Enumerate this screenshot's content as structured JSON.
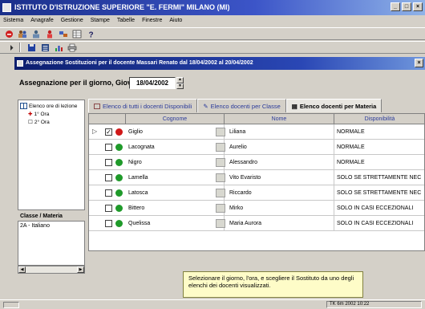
{
  "app": {
    "title": "ISTITUTO D'ISTRUZIONE SUPERIORE \"E. FERMI\" MILANO (MI)"
  },
  "menu": [
    "Sistema",
    "Anagrafe",
    "Gestione",
    "Stampe",
    "Tabelle",
    "Finestre",
    "Aiuto"
  ],
  "toolbar1": [
    "exit-icon",
    "people-icon",
    "group-icon",
    "person-icon",
    "transfer-icon",
    "table-icon",
    "help-icon"
  ],
  "toolbar2": [
    "arrow-icon",
    "save-icon",
    "list-icon",
    "chart-icon",
    "print-icon"
  ],
  "child": {
    "title": "Assegnazione Sostituzioni per il docente Massari Renato dal 18/04/2002 al 20/04/2002"
  },
  "assign": {
    "label": "Assegnazione per il giorno, Giovedì",
    "date": "18/04/2002"
  },
  "tree": {
    "root": "Elenco ore di lezione",
    "items": [
      "1° Ora",
      "2° Ora"
    ]
  },
  "classe": {
    "header": "Classe / Materia",
    "value": "2A - Italiano"
  },
  "tabs": [
    "Elenco di tutti i docenti Disponibili",
    "Elenco docenti per Classe",
    "Elenco docenti per Materia"
  ],
  "grid": {
    "columns": [
      "Cognome",
      "Nome",
      "Disponibilità"
    ],
    "rows": [
      {
        "cognome": "Giglio",
        "nome": "Liliana",
        "disp": "NORMALE",
        "checked": "✓",
        "status_color": "#d01818"
      },
      {
        "cognome": "Lacognata",
        "nome": "Aurelio",
        "disp": "NORMALE",
        "checked": "",
        "status_color": "#1f9a2a"
      },
      {
        "cognome": "Nigro",
        "nome": "Alessandro",
        "disp": "NORMALE",
        "checked": "",
        "status_color": "#1f9a2a"
      },
      {
        "cognome": "Lamella",
        "nome": "Vito Evaristo",
        "disp": "SOLO SE STRETTAMENTE NEC",
        "checked": "",
        "status_color": "#1f9a2a"
      },
      {
        "cognome": "Latosca",
        "nome": "Riccardo",
        "disp": "SOLO SE STRETTAMENTE NEC",
        "checked": "",
        "status_color": "#1f9a2a"
      },
      {
        "cognome": "Bittero",
        "nome": "Mirko",
        "disp": "SOLO IN CASI ECCEZIONALI",
        "checked": "",
        "status_color": "#1f9a2a"
      },
      {
        "cognome": "Quelissa",
        "nome": "Maria Aurora",
        "disp": "SOLO IN CASI ECCEZIONALI",
        "checked": "",
        "status_color": "#1f9a2a"
      }
    ]
  },
  "note": {
    "text": "Selezionare il giorno, l'ora, e scegliere il Sostituto da uno degli elenchi dei docenti visualizzati."
  },
  "status": {
    "right": "TK 6m 2002 10:22"
  }
}
